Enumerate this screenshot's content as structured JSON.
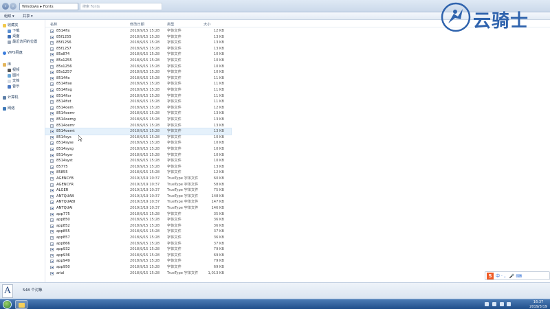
{
  "address_bar": {
    "breadcrumb": "Windows ▸ Fonts",
    "search_placeholder": "搜索 Fonts"
  },
  "toolbar": {
    "organize": "组织 ▾",
    "share": "共享 ▾"
  },
  "nav": {
    "favorites": "收藏夹",
    "downloads": "下载",
    "desktop": "桌面",
    "recent": "最近访问的位置",
    "wps": "WPS网盘",
    "libraries": "库",
    "videos": "视频",
    "pictures": "图片",
    "documents": "文档",
    "music": "音乐",
    "computer": "计算机",
    "network": "网络"
  },
  "columns": {
    "name": "名称",
    "date": "修改日期",
    "type": "类型",
    "size": "大小"
  },
  "files": [
    {
      "name": "8514fix",
      "date": "2018/9/15 15:28",
      "type": "字体文件",
      "size": "12 KB"
    },
    {
      "name": "85f1255",
      "date": "2018/9/15 15:28",
      "type": "字体文件",
      "size": "13 KB"
    },
    {
      "name": "85f1256",
      "date": "2018/9/15 15:28",
      "type": "字体文件",
      "size": "13 KB"
    },
    {
      "name": "85f1257",
      "date": "2018/9/15 15:28",
      "type": "字体文件",
      "size": "13 KB"
    },
    {
      "name": "85s874",
      "date": "2018/9/15 15:28",
      "type": "字体文件",
      "size": "10 KB"
    },
    {
      "name": "85s1255",
      "date": "2018/9/15 15:28",
      "type": "字体文件",
      "size": "10 KB"
    },
    {
      "name": "85s1256",
      "date": "2018/9/15 15:28",
      "type": "字体文件",
      "size": "10 KB"
    },
    {
      "name": "85s1257",
      "date": "2018/9/15 15:28",
      "type": "字体文件",
      "size": "10 KB"
    },
    {
      "name": "8514fix",
      "date": "2018/9/15 15:28",
      "type": "字体文件",
      "size": "11 KB"
    },
    {
      "name": "8514fixe",
      "date": "2018/9/15 15:28",
      "type": "字体文件",
      "size": "11 KB"
    },
    {
      "name": "8514fixg",
      "date": "2018/9/15 15:28",
      "type": "字体文件",
      "size": "11 KB"
    },
    {
      "name": "8514fixr",
      "date": "2018/9/15 15:28",
      "type": "字体文件",
      "size": "11 KB"
    },
    {
      "name": "8514fixt",
      "date": "2018/9/15 15:28",
      "type": "字体文件",
      "size": "11 KB"
    },
    {
      "name": "8514oem",
      "date": "2018/9/15 15:28",
      "type": "字体文件",
      "size": "12 KB"
    },
    {
      "name": "8514oemr",
      "date": "2018/9/15 15:28",
      "type": "字体文件",
      "size": "13 KB"
    },
    {
      "name": "8514oemg",
      "date": "2018/9/15 15:28",
      "type": "字体文件",
      "size": "13 KB"
    },
    {
      "name": "8514oemr",
      "date": "2018/9/15 15:28",
      "type": "字体文件",
      "size": "13 KB"
    },
    {
      "name": "8514oemt",
      "date": "2018/9/15 15:28",
      "type": "字体文件",
      "size": "13 KB"
    },
    {
      "name": "8514sys",
      "date": "2018/9/15 15:28",
      "type": "字体文件",
      "size": "10 KB"
    },
    {
      "name": "8514syse",
      "date": "2018/9/15 15:28",
      "type": "字体文件",
      "size": "10 KB"
    },
    {
      "name": "8514sysg",
      "date": "2018/9/15 15:28",
      "type": "字体文件",
      "size": "10 KB"
    },
    {
      "name": "8514sysr",
      "date": "2018/9/15 15:28",
      "type": "字体文件",
      "size": "10 KB"
    },
    {
      "name": "8514syst",
      "date": "2018/9/15 15:28",
      "type": "字体文件",
      "size": "10 KB"
    },
    {
      "name": "85775",
      "date": "2018/9/15 15:28",
      "type": "字体文件",
      "size": "13 KB"
    },
    {
      "name": "85855",
      "date": "2018/9/15 15:28",
      "type": "字体文件",
      "size": "12 KB"
    },
    {
      "name": "AGENCYB",
      "date": "2019/3/19 10:37",
      "type": "TrueType 字体文件",
      "size": "60 KB"
    },
    {
      "name": "AGENCYR",
      "date": "2019/3/19 10:37",
      "type": "TrueType 字体文件",
      "size": "58 KB"
    },
    {
      "name": "ALGER",
      "date": "2019/3/19 10:37",
      "type": "TrueType 字体文件",
      "size": "75 KB"
    },
    {
      "name": "ANTQUAB",
      "date": "2019/3/19 10:37",
      "type": "TrueType 字体文件",
      "size": "148 KB"
    },
    {
      "name": "ANTQUABI",
      "date": "2019/3/19 10:37",
      "type": "TrueType 字体文件",
      "size": "147 KB"
    },
    {
      "name": "ANTQUAI",
      "date": "2019/3/19 10:37",
      "type": "TrueType 字体文件",
      "size": "146 KB"
    },
    {
      "name": "app775",
      "date": "2018/9/15 15:28",
      "type": "字体文件",
      "size": "35 KB"
    },
    {
      "name": "app850",
      "date": "2018/9/15 15:28",
      "type": "字体文件",
      "size": "36 KB"
    },
    {
      "name": "app852",
      "date": "2018/9/15 15:28",
      "type": "字体文件",
      "size": "36 KB"
    },
    {
      "name": "app855",
      "date": "2018/9/15 15:28",
      "type": "字体文件",
      "size": "37 KB"
    },
    {
      "name": "app857",
      "date": "2018/9/15 15:28",
      "type": "字体文件",
      "size": "36 KB"
    },
    {
      "name": "app866",
      "date": "2018/9/15 15:28",
      "type": "字体文件",
      "size": "37 KB"
    },
    {
      "name": "app932",
      "date": "2018/9/15 15:28",
      "type": "字体文件",
      "size": "79 KB"
    },
    {
      "name": "app936",
      "date": "2018/9/15 15:28",
      "type": "字体文件",
      "size": "69 KB"
    },
    {
      "name": "app949",
      "date": "2018/9/15 15:28",
      "type": "字体文件",
      "size": "79 KB"
    },
    {
      "name": "app950",
      "date": "2018/9/15 15:28",
      "type": "字体文件",
      "size": "69 KB"
    },
    {
      "name": "arial",
      "date": "2018/9/15 15:28",
      "type": "TrueType 字体文件",
      "size": "1,013 KB"
    }
  ],
  "selected_index": 17,
  "details": {
    "count": "548 个对象"
  },
  "ime": {
    "label": "中·，🎤⌨"
  },
  "clock": {
    "time": "16:37",
    "date": "2019/3/19"
  },
  "logo": {
    "text": "云骑士"
  }
}
